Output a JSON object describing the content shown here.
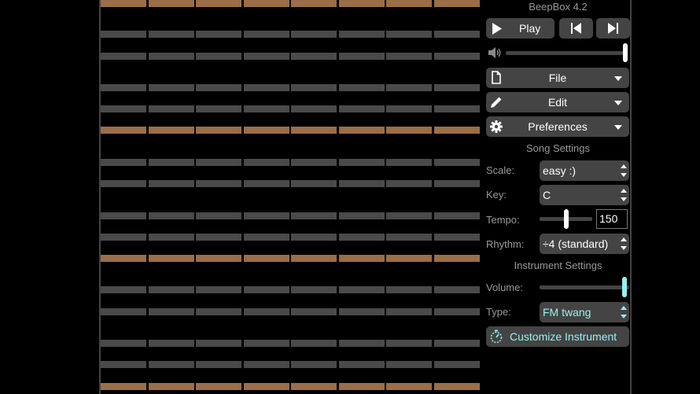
{
  "app_title": "BeepBox 4.2",
  "transport": {
    "play_label": "Play",
    "play_icon": "play-icon",
    "prev_icon": "skip-previous-icon",
    "next_icon": "skip-next-icon"
  },
  "volume": {
    "icon": "speaker-icon",
    "level": 1.0
  },
  "menus": [
    {
      "label": "File",
      "icon": "file-icon"
    },
    {
      "label": "Edit",
      "icon": "pencil-icon"
    },
    {
      "label": "Preferences",
      "icon": "gear-icon"
    }
  ],
  "song_settings": {
    "title": "Song Settings",
    "scale_label": "Scale:",
    "scale_value": "easy :)",
    "key_label": "Key:",
    "key_value": "C",
    "tempo_label": "Tempo:",
    "tempo_value": "150",
    "tempo_slider_fraction": 0.5,
    "rhythm_label": "Rhythm:",
    "rhythm_value": "÷4 (standard)"
  },
  "instrument_settings": {
    "title": "Instrument Settings",
    "volume_label": "Volume:",
    "volume_fraction": 0.97,
    "type_label": "Type:",
    "type_value": "FM twang",
    "customize_label": "Customize Instrument",
    "customize_icon": "dial-icon"
  },
  "colors": {
    "accent_teal": "#98f0f0",
    "tonic_row": "#9a6e48",
    "grid_row": "#4a4a4a",
    "control_bg": "#444444"
  }
}
